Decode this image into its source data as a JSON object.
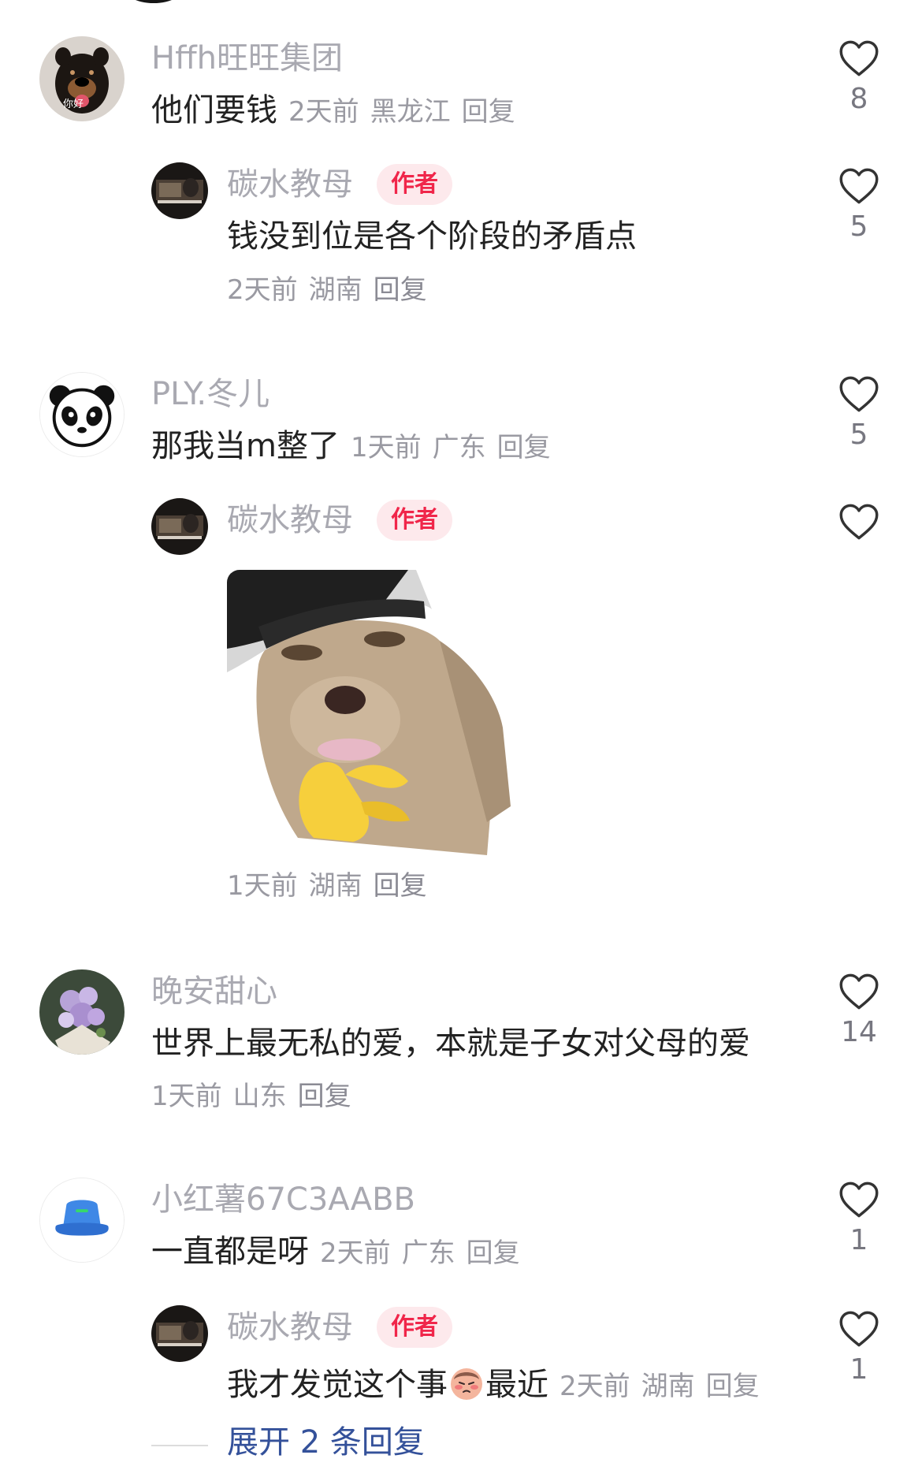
{
  "comments": [
    {
      "username": "Hffh旺旺集团",
      "text": "他们要钱",
      "time": "2天前",
      "location": "黑龙江",
      "reply_label": "回复",
      "likes": "8",
      "avatar_caption": "你好",
      "reply": {
        "username": "碳水教母",
        "badge": "作者",
        "text": "钱没到位是各个阶段的矛盾点",
        "time": "2天前",
        "location": "湖南",
        "reply_label": "回复",
        "likes": "5"
      }
    },
    {
      "username": "PLY.冬儿",
      "text": "那我当m整了",
      "time": "1天前",
      "location": "广东",
      "reply_label": "回复",
      "likes": "5",
      "reply": {
        "username": "碳水教母",
        "badge": "作者",
        "sticker": "dog-thinking-sticker",
        "time": "1天前",
        "location": "湖南",
        "reply_label": "回复"
      }
    },
    {
      "username": "晚安甜心",
      "text": "世界上最无私的爱，本就是子女对父母的爱",
      "time": "1天前",
      "location": "山东",
      "reply_label": "回复",
      "likes": "14"
    },
    {
      "username": "小红薯67C3AABB",
      "text": "一直都是呀",
      "time": "2天前",
      "location": "广东",
      "reply_label": "回复",
      "likes": "1",
      "reply": {
        "username": "碳水教母",
        "badge": "作者",
        "text_before": "我才发觉这个事",
        "emoji": "blushing-emoji",
        "text_after": "最近",
        "time": "2天前",
        "location": "湖南",
        "reply_label": "回复",
        "likes": "1"
      }
    }
  ],
  "expand_replies": "展开 2 条回复",
  "colors": {
    "username": "#a9a9b1",
    "text": "#222222",
    "meta": "#9a9aa2",
    "author_badge_bg": "#fde9ec",
    "author_badge_text": "#f0264a",
    "expand_link": "#34519a"
  },
  "icons": {
    "like": "heart-outline-icon"
  }
}
